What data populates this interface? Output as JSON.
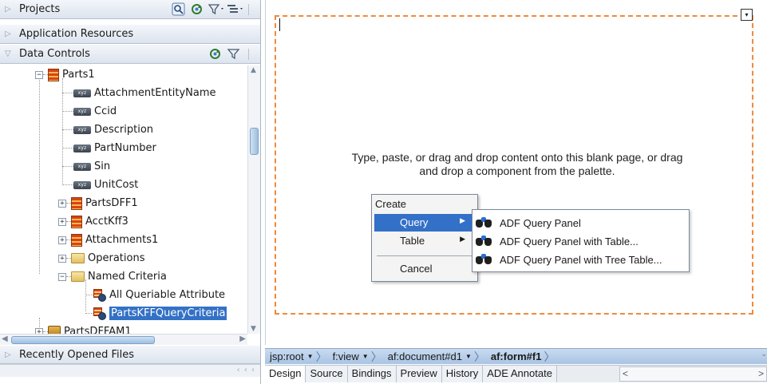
{
  "left_panel": {
    "sections": {
      "projects": "Projects",
      "application_resources": "Application Resources",
      "data_controls": "Data Controls",
      "recently_opened": "Recently Opened Files"
    },
    "tree": [
      {
        "label": "Parts1",
        "icon": "collection-icon"
      },
      {
        "label": "AttachmentEntityName",
        "icon": "attribute-icon"
      },
      {
        "label": "Ccid",
        "icon": "attribute-icon"
      },
      {
        "label": "Description",
        "icon": "attribute-icon"
      },
      {
        "label": "PartNumber",
        "icon": "attribute-icon"
      },
      {
        "label": "Sin",
        "icon": "attribute-icon"
      },
      {
        "label": "UnitCost",
        "icon": "attribute-icon"
      },
      {
        "label": "PartsDFF1",
        "icon": "collection-icon"
      },
      {
        "label": "AcctKff3",
        "icon": "collection-icon"
      },
      {
        "label": "Attachments1",
        "icon": "collection-icon"
      },
      {
        "label": "Operations",
        "icon": "folder-icon"
      },
      {
        "label": "Named Criteria",
        "icon": "folder-icon"
      },
      {
        "label": "All Queriable Attribute",
        "icon": "criteria-icon"
      },
      {
        "label": "PartsKFFQueryCriteria",
        "icon": "criteria-icon"
      },
      {
        "label": "PartsDFFAM1",
        "icon": "data-control-icon"
      }
    ],
    "bottom_chevrons": "‹ ‹ ‹"
  },
  "editor": {
    "blank_message": "Type, paste, or drag and drop content onto this blank page, or drag and drop a component from the palette.",
    "corner_glyph": "▾"
  },
  "context_menu": {
    "title": "Create",
    "items": [
      "Query",
      "Table"
    ],
    "cancel": "Cancel"
  },
  "submenu": {
    "items": [
      "ADF Query Panel",
      "ADF Query Panel with Table...",
      "ADF Query Panel with Tree Table..."
    ]
  },
  "breadcrumbs": [
    "jsp:root",
    "f:view",
    "af:document#d1",
    "af:form#f1"
  ],
  "tabs": [
    "Design",
    "Source",
    "Bindings",
    "Preview",
    "History",
    "ADE Annotate"
  ],
  "colors": {
    "selection": "#3371c6",
    "menu_highlight": "#3370c8",
    "dashed_border": "#f08a3c"
  }
}
